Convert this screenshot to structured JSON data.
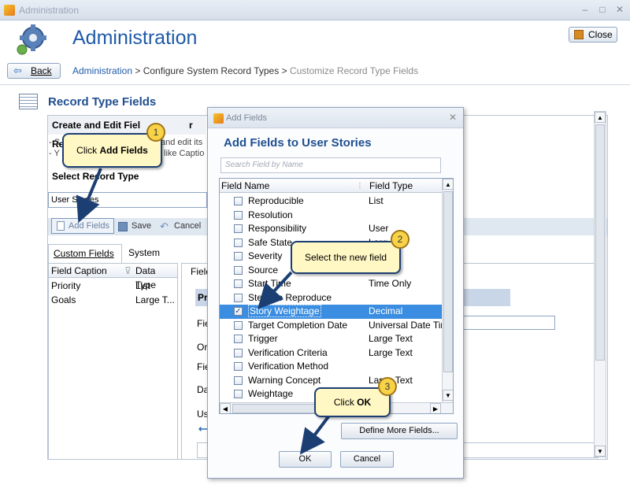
{
  "window": {
    "title": "Administration",
    "minimize": "–",
    "maximize": "□",
    "close": "✕"
  },
  "header": {
    "title": "Administration",
    "close_label": "Close",
    "back_label": "Back"
  },
  "breadcrumb": {
    "link": "Administration",
    "middle": " > Configure System Record Types > ",
    "current": "Customize Record Type Fields"
  },
  "section": {
    "title": "Record Type Fields"
  },
  "left": {
    "create_heading": "Create and Edit Fiel",
    "create_heading_tail": "r Record",
    "bullet1_a": "S",
    "bullet1_b": "and edit its",
    "bullet2_a": "Y",
    "bullet2_b": "like Captio",
    "select_heading": "Select Record Type",
    "record_type_value": "User Stories"
  },
  "toolbar": {
    "add_fields": "Add Fields",
    "save": "Save",
    "cancel": "Cancel"
  },
  "tabs": [
    {
      "label": "Custom Fields"
    },
    {
      "label": "System Fields"
    }
  ],
  "grid": {
    "columns": [
      "Field Caption",
      "Data Type"
    ],
    "rows": [
      {
        "caption": "Priority",
        "type": "List"
      },
      {
        "caption": "Goals",
        "type": "Large T..."
      }
    ]
  },
  "right_fragments": {
    "tab": "Field",
    "band": "Pr",
    "f1": "Fie",
    "f2": "Or",
    "f3": "Fie",
    "f4": "Da",
    "f5": "Us"
  },
  "dialog": {
    "title": "Add Fields",
    "heading": "Add Fields to User Stories",
    "search_placeholder": "Search Field by Name",
    "columns": [
      "Field Name",
      "Field Type"
    ],
    "rows": [
      {
        "name": "Reproducible",
        "type": "List",
        "checked": false
      },
      {
        "name": "Resolution",
        "type": "",
        "checked": false
      },
      {
        "name": "Responsibility",
        "type": "User",
        "checked": false
      },
      {
        "name": "Safe State",
        "type": "Larg",
        "checked": false
      },
      {
        "name": "Severity",
        "type": "",
        "checked": false
      },
      {
        "name": "Source",
        "type": "",
        "checked": false
      },
      {
        "name": "Start Time",
        "type": "Time Only",
        "checked": false
      },
      {
        "name": "Steps to Reproduce",
        "type": "",
        "checked": false
      },
      {
        "name": "Story Weightage",
        "type": "Decimal",
        "checked": true
      },
      {
        "name": "Target Completion Date",
        "type": "Universal Date Tim",
        "checked": false
      },
      {
        "name": "Trigger",
        "type": "Large Text",
        "checked": false
      },
      {
        "name": "Verification Criteria",
        "type": "Large Text",
        "checked": false
      },
      {
        "name": "Verification Method",
        "type": "",
        "checked": false
      },
      {
        "name": "Warning Concept",
        "type": "Large Text",
        "checked": false
      },
      {
        "name": "Weightage",
        "type": "al",
        "checked": false
      }
    ],
    "define_more": "Define More Fields...",
    "ok": "OK",
    "cancel": "Cancel"
  },
  "callouts": [
    {
      "number": "1",
      "text_a": "Click ",
      "text_b": "Add Fields"
    },
    {
      "number": "2",
      "text_a": "Select the new field",
      "text_b": ""
    },
    {
      "number": "3",
      "text_a": "Click ",
      "text_b": "OK"
    }
  ],
  "colors": {
    "accent": "#1f5ba8",
    "selection": "#3a8de0",
    "callout_bg": "#fff7c4",
    "badge": "#f8d348"
  }
}
